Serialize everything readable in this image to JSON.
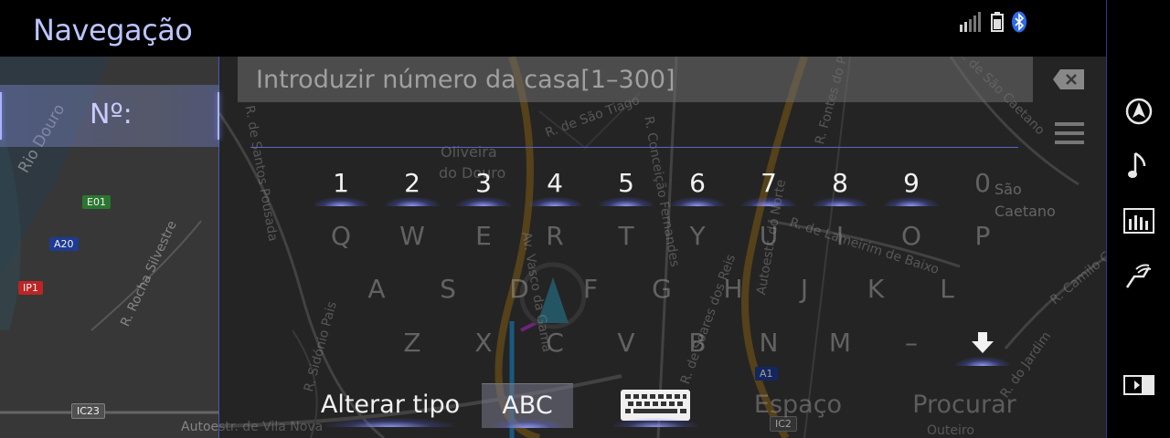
{
  "header": {
    "title": "Navegação"
  },
  "field": {
    "label": "Nº:",
    "placeholder": "Introduzir número da casa[1–300]",
    "value": ""
  },
  "keyboard": {
    "digits": [
      {
        "label": "1",
        "enabled": true
      },
      {
        "label": "2",
        "enabled": true
      },
      {
        "label": "3",
        "enabled": true
      },
      {
        "label": "4",
        "enabled": true
      },
      {
        "label": "5",
        "enabled": true
      },
      {
        "label": "6",
        "enabled": true
      },
      {
        "label": "7",
        "enabled": true
      },
      {
        "label": "8",
        "enabled": true
      },
      {
        "label": "9",
        "enabled": true
      },
      {
        "label": "0",
        "enabled": false
      }
    ],
    "row1": [
      "Q",
      "W",
      "E",
      "R",
      "T",
      "Y",
      "U",
      "I",
      "O",
      "P"
    ],
    "row2": [
      "A",
      "S",
      "D",
      "F",
      "G",
      "H",
      "J",
      "K",
      "L"
    ],
    "row3": [
      "Z",
      "X",
      "C",
      "V",
      "B",
      "N",
      "M",
      "–"
    ],
    "bottom": {
      "change_type": "Alterar tipo",
      "abc": "ABC",
      "space": "Espaço",
      "search": "Procurar"
    }
  },
  "map_labels": {
    "rio_douro": "Rio Douro",
    "r_santos_pousada": "R. de Santos Pousada",
    "oliveira": "Oliveira",
    "do_douro": "do Douro",
    "r_sao_tiago": "R. de São Tiago",
    "r_conceicao": "R. Conceição Fernandes",
    "r_fontes": "R. Fontes do P",
    "r_sao_caetano": "R. de São Caetano",
    "sao": "São",
    "caetano": "Caetano",
    "r_lameirim": "R. de Lameirim de Baixo",
    "r_rocha": "R. Rocha Silvestre",
    "av_vasco": "Av. Vasco da Gama",
    "r_soares": "R. de Soares dos Reis",
    "autoestr_norte": "Autoestr. do Norte",
    "r_sidonio": "R. Sidónio Pais",
    "autoestr_vila": "Autoestr. de Vila Nova",
    "r_jardim": "R. do Jardim",
    "r_camilo": "R. Camilo Cas",
    "outeiro": "Outeiro",
    "e01": "E01",
    "a20": "A20",
    "ip1": "IP1",
    "ic23": "IC23",
    "a1": "A1",
    "ic2": "IC2"
  },
  "sidebar_icons": [
    "navigation-icon",
    "music-note-icon",
    "equalizer-icon",
    "climate-seat-icon",
    "split-screen-icon"
  ],
  "colors": {
    "accent": "#bcc4ff",
    "highlight": "#7f8cff",
    "bluetooth": "#3a7bff"
  }
}
